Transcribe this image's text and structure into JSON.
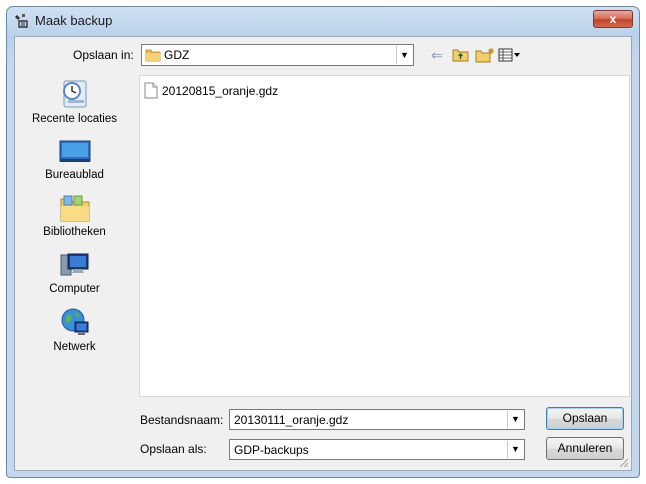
{
  "window": {
    "title": "Maak backup",
    "close_label": "x"
  },
  "toolbar": {
    "lookin_label": "Opslaan in:",
    "lookin_value": "GDZ",
    "back_icon": "back-arrow-icon",
    "up_icon": "up-folder-icon",
    "newfolder_icon": "new-folder-icon",
    "views_icon": "views-menu-icon"
  },
  "places": [
    {
      "label": "Recente locaties",
      "icon": "recent-locations-icon"
    },
    {
      "label": "Bureaublad",
      "icon": "desktop-icon"
    },
    {
      "label": "Bibliotheken",
      "icon": "libraries-icon"
    },
    {
      "label": "Computer",
      "icon": "computer-icon"
    },
    {
      "label": "Netwerk",
      "icon": "network-icon"
    }
  ],
  "files": [
    {
      "name": "20120815_oranje.gdz",
      "icon": "file-icon"
    }
  ],
  "form": {
    "filename_label": "Bestandsnaam:",
    "filename_value": "20130111_oranje.gdz",
    "type_label": "Opslaan als:",
    "type_value": "GDP-backups",
    "save_label": "Opslaan",
    "cancel_label": "Annuleren"
  },
  "colors": {
    "title_gradient": "#b9d1ea",
    "close_red": "#c0432a",
    "panel": "#f0f0f0",
    "folder_yellow": "#e8b84a"
  }
}
